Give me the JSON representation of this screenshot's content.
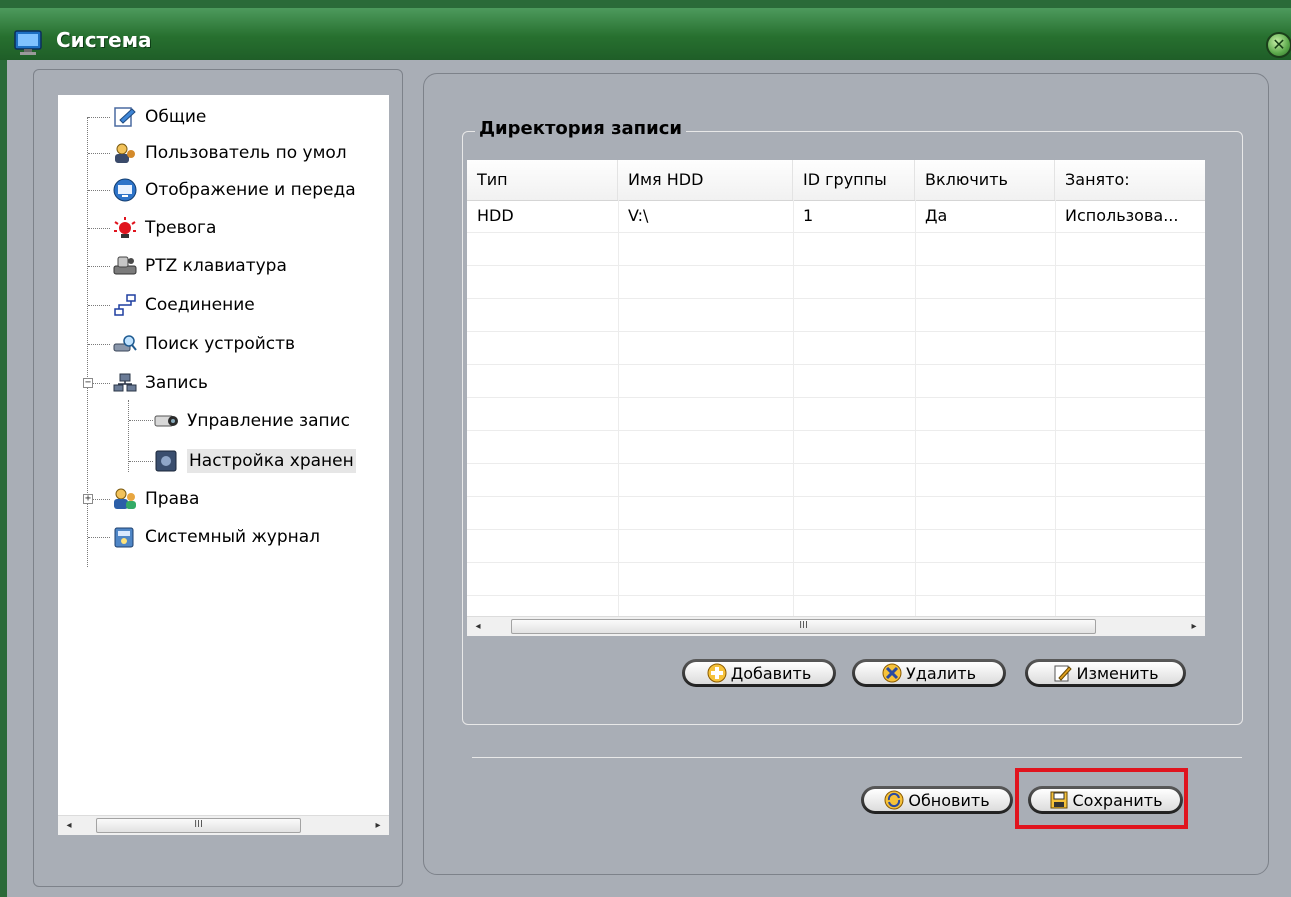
{
  "window": {
    "title": "Система",
    "icons": {
      "title": "monitor-icon",
      "close": "close-icon"
    }
  },
  "tree": {
    "items": [
      {
        "label": "Общие",
        "icon": "general-settings-icon"
      },
      {
        "label": "Пользователь по умол",
        "icon": "default-user-icon"
      },
      {
        "label": "Отображение и переда",
        "icon": "display-icon"
      },
      {
        "label": "Тревога",
        "icon": "alarm-icon"
      },
      {
        "label": "PTZ клавиатура",
        "icon": "ptz-keyboard-icon"
      },
      {
        "label": "Соединение",
        "icon": "connection-icon"
      },
      {
        "label": "Поиск устройств",
        "icon": "device-search-icon"
      },
      {
        "label": "Запись",
        "icon": "record-icon"
      },
      {
        "label": "Управление запис",
        "icon": "camera-icon"
      },
      {
        "label": "Настройка хранен",
        "icon": "storage-icon"
      },
      {
        "label": "Права",
        "icon": "users-icon"
      },
      {
        "label": "Системный журнал",
        "icon": "log-icon"
      }
    ],
    "expander_minus": "−",
    "expander_plus": "+",
    "scroll_thumb": "III",
    "scroll_left": "◂",
    "scroll_right": "▸",
    "selected_item": "Настройка хранен"
  },
  "record_dir": {
    "title": "Директория записи",
    "columns": [
      "Тип",
      "Имя HDD",
      "ID группы",
      "Включить",
      "Занято:"
    ],
    "rows": [
      [
        "HDD",
        "V:\\",
        "1",
        "Да",
        "Использова..."
      ]
    ],
    "scroll_thumb": "III",
    "scroll_left": "◂",
    "scroll_right": "▸"
  },
  "buttons": {
    "add": "Добавить",
    "delete": "Удалить",
    "edit": "Изменить",
    "refresh": "Обновить",
    "save": "Сохранить"
  },
  "colors": {
    "titlebar": "#27702f",
    "panel": "#a9aeb6",
    "highlight": "#e0141e"
  }
}
